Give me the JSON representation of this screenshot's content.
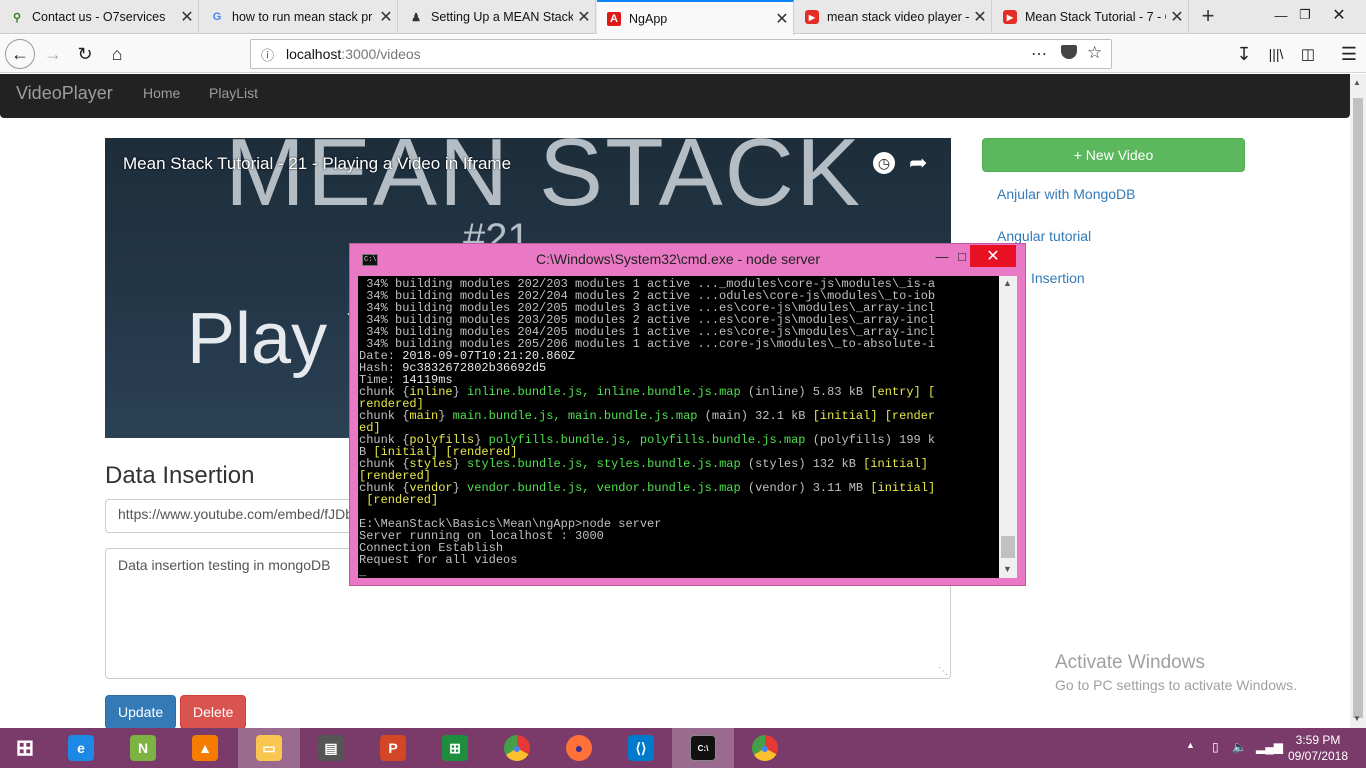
{
  "browser": {
    "tabs": [
      {
        "title": "Contact us - O7services",
        "icon": "07-favicon"
      },
      {
        "title": "how to run mean stack pr",
        "icon": "google-g-icon"
      },
      {
        "title": "Setting Up a MEAN Stack S",
        "icon": "article-icon"
      },
      {
        "title": "NgApp",
        "icon": "angular-icon"
      },
      {
        "title": "mean stack video player -",
        "icon": "youtube-icon"
      },
      {
        "title": "Mean Stack Tutorial - 7 - C",
        "icon": "youtube-icon"
      }
    ],
    "active_tab_index": 3,
    "url_host": "localhost",
    "url_path": ":3000/videos"
  },
  "app": {
    "brand": "VideoPlayer",
    "nav": [
      "Home",
      "PlayList"
    ],
    "video": {
      "title": "Mean Stack Tutorial - 21 - Playing a Video in Iframe",
      "thumb_big": "MEAN STACK",
      "thumb_num": "#21",
      "thumb_play": "Play Y"
    },
    "section_title": "Data Insertion",
    "url_value": "https://www.youtube.com/embed/fJDb",
    "description_value": "Data insertion testing in mongoDB",
    "update_label": "Update",
    "delete_label": "Delete",
    "new_video_label": "+ New Video",
    "video_links": [
      "Anjular with MongoDB",
      "Angular tutorial",
      "Insertion"
    ]
  },
  "windows_watermark": {
    "line1": "Activate Windows",
    "line2": "Go to PC settings to activate Windows."
  },
  "cmd": {
    "title": "C:\\Windows\\System32\\cmd.exe - node  server",
    "lines": [
      {
        "segs": [
          {
            "t": " 34% building modules 202/203 modules 1 active ..._modules\\core-js\\modules\\_is-a",
            "c": ""
          }
        ]
      },
      {
        "segs": [
          {
            "t": " 34% building modules 202/204 modules 2 active ...odules\\core-js\\modules\\_to-iob",
            "c": ""
          }
        ]
      },
      {
        "segs": [
          {
            "t": " 34% building modules 202/205 modules 3 active ...es\\core-js\\modules\\_array-incl",
            "c": ""
          }
        ]
      },
      {
        "segs": [
          {
            "t": " 34% building modules 203/205 modules 2 active ...es\\core-js\\modules\\_array-incl",
            "c": ""
          }
        ]
      },
      {
        "segs": [
          {
            "t": " 34% building modules 204/205 modules 1 active ...es\\core-js\\modules\\_array-incl",
            "c": ""
          }
        ]
      },
      {
        "segs": [
          {
            "t": " 34% building modules 205/206 modules 1 active ...core-js\\modules\\_to-absolute-i",
            "c": ""
          }
        ]
      },
      {
        "segs": [
          {
            "t": "Date: ",
            "c": ""
          },
          {
            "t": "2018-09-07T10:21:20.860Z",
            "c": "w"
          }
        ]
      },
      {
        "segs": [
          {
            "t": "Hash: ",
            "c": ""
          },
          {
            "t": "9c3832672802b36692d5",
            "c": "w"
          }
        ]
      },
      {
        "segs": [
          {
            "t": "Time: ",
            "c": ""
          },
          {
            "t": "14119ms",
            "c": "w"
          }
        ]
      },
      {
        "segs": [
          {
            "t": "chunk {",
            "c": ""
          },
          {
            "t": "inline",
            "c": "y"
          },
          {
            "t": "} ",
            "c": ""
          },
          {
            "t": "inline.bundle.js, inline.bundle.js.map",
            "c": "g"
          },
          {
            "t": " (inline) 5.83 kB ",
            "c": ""
          },
          {
            "t": "[entry] [",
            "c": "y"
          }
        ]
      },
      {
        "segs": [
          {
            "t": "rendered]",
            "c": "y"
          }
        ]
      },
      {
        "segs": [
          {
            "t": "chunk {",
            "c": ""
          },
          {
            "t": "main",
            "c": "y"
          },
          {
            "t": "} ",
            "c": ""
          },
          {
            "t": "main.bundle.js, main.bundle.js.map",
            "c": "g"
          },
          {
            "t": " (main) 32.1 kB ",
            "c": ""
          },
          {
            "t": "[initial] [render",
            "c": "y"
          }
        ]
      },
      {
        "segs": [
          {
            "t": "ed]",
            "c": "y"
          }
        ]
      },
      {
        "segs": [
          {
            "t": "chunk {",
            "c": ""
          },
          {
            "t": "polyfills",
            "c": "y"
          },
          {
            "t": "} ",
            "c": ""
          },
          {
            "t": "polyfills.bundle.js, polyfills.bundle.js.map",
            "c": "g"
          },
          {
            "t": " (polyfills) 199 k",
            "c": ""
          }
        ]
      },
      {
        "segs": [
          {
            "t": "B ",
            "c": ""
          },
          {
            "t": "[initial] [rendered]",
            "c": "y"
          }
        ]
      },
      {
        "segs": [
          {
            "t": "chunk {",
            "c": ""
          },
          {
            "t": "styles",
            "c": "y"
          },
          {
            "t": "} ",
            "c": ""
          },
          {
            "t": "styles.bundle.js, styles.bundle.js.map",
            "c": "g"
          },
          {
            "t": " (styles) 132 kB ",
            "c": ""
          },
          {
            "t": "[initial]",
            "c": "y"
          }
        ]
      },
      {
        "segs": [
          {
            "t": "[rendered]",
            "c": "y"
          }
        ]
      },
      {
        "segs": [
          {
            "t": "chunk {",
            "c": ""
          },
          {
            "t": "vendor",
            "c": "y"
          },
          {
            "t": "} ",
            "c": ""
          },
          {
            "t": "vendor.bundle.js, vendor.bundle.js.map",
            "c": "g"
          },
          {
            "t": " (vendor) 3.11 MB ",
            "c": ""
          },
          {
            "t": "[initial]",
            "c": "y"
          }
        ]
      },
      {
        "segs": [
          {
            "t": " [rendered]",
            "c": "y"
          }
        ]
      },
      {
        "segs": [
          {
            "t": "",
            "c": ""
          }
        ]
      },
      {
        "segs": [
          {
            "t": "E:\\MeanStack\\Basics\\Mean\\ngApp>node server",
            "c": ""
          }
        ]
      },
      {
        "segs": [
          {
            "t": "Server running on localhost : 3000",
            "c": ""
          }
        ]
      },
      {
        "segs": [
          {
            "t": "Connection Establish",
            "c": ""
          }
        ]
      },
      {
        "segs": [
          {
            "t": "Request for all videos",
            "c": ""
          }
        ]
      },
      {
        "segs": [
          {
            "t": "_",
            "c": ""
          }
        ]
      }
    ]
  },
  "taskbar": {
    "apps": [
      {
        "icon": "windows-start-icon",
        "label": ""
      },
      {
        "icon": "internet-explorer-icon",
        "label": "e"
      },
      {
        "icon": "notepad-plus-icon",
        "label": "N"
      },
      {
        "icon": "vlc-icon",
        "label": "▲"
      },
      {
        "icon": "file-explorer-icon",
        "label": "▭"
      },
      {
        "icon": "presentation-icon",
        "label": "▤"
      },
      {
        "icon": "powerpoint-icon",
        "label": "P"
      },
      {
        "icon": "store-icon",
        "label": "⊞"
      },
      {
        "icon": "chrome-icon",
        "label": "●"
      },
      {
        "icon": "firefox-icon",
        "label": "●"
      },
      {
        "icon": "vscode-icon",
        "label": "⟨⟩"
      },
      {
        "icon": "cmd-icon",
        "label": "C:\\"
      },
      {
        "icon": "chrome-icon",
        "label": "●"
      }
    ],
    "time": "3:59 PM",
    "date": "09/07/2018"
  }
}
